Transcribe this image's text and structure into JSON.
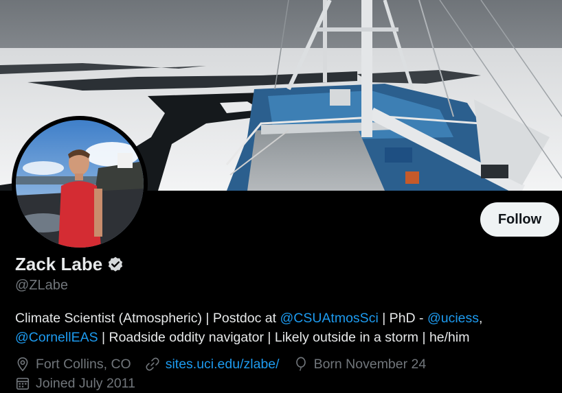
{
  "profile": {
    "display_name": "Zack Labe",
    "handle": "@ZLabe",
    "follow_label": "Follow"
  },
  "bio": {
    "t1": "Climate Scientist (Atmospheric) | Postdoc at ",
    "m1": "@CSUAtmosSci",
    "t2": " | PhD - ",
    "m2": "@uciess",
    "t3": ",",
    "m3": "@CornellEAS",
    "t4": " | Roadside oddity navigator | Likely outside in a storm | he/him"
  },
  "meta": {
    "location": "Fort Collins, CO",
    "website": "sites.uci.edu/zlabe/",
    "birthday": "Born November 24",
    "joined": "Joined July 2011"
  },
  "icons": {
    "verified": "verified-badge-icon",
    "location": "location-pin-icon",
    "website": "link-icon",
    "birthday": "balloon-icon",
    "joined": "calendar-icon"
  },
  "colors": {
    "link": "#1d9bf0",
    "muted": "#71767b",
    "text": "#e7e9ea",
    "background": "#000000"
  }
}
